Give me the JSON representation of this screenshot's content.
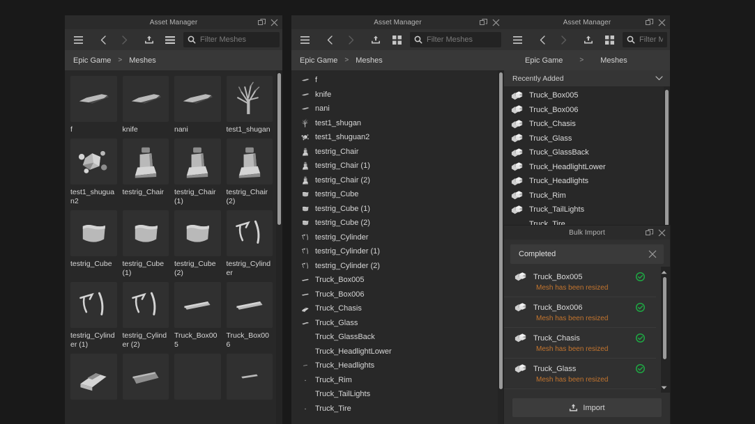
{
  "window": {
    "title": "Asset Manager",
    "undock_icon": "undock-icon",
    "close_icon": "close-icon"
  },
  "toolbar": {
    "menu_icon": "hamburger-menu-icon",
    "back_icon": "chevron-left-icon",
    "forward_icon": "chevron-right-icon",
    "import_icon": "upload-icon",
    "list_view_icon": "list-view-icon",
    "grid_view_icon": "grid-view-icon",
    "search_icon": "search-icon",
    "search_placeholder": "Filter Meshes",
    "search_placeholder_short": "Filter M",
    "search_value": ""
  },
  "breadcrumb": {
    "root": "Epic Game",
    "separator": ">",
    "current": "Meshes"
  },
  "panel_grid": {
    "view_mode": "grid",
    "assets": [
      {
        "label": "f",
        "shape": "knife"
      },
      {
        "label": "knife",
        "shape": "knife"
      },
      {
        "label": "nani",
        "shape": "knife"
      },
      {
        "label": "test1_shugan",
        "shape": "tree"
      },
      {
        "label": "test1_shuguan2",
        "shape": "cluster"
      },
      {
        "label": "testrig_Chair",
        "shape": "chair"
      },
      {
        "label": "testrig_Chair (1)",
        "shape": "chair"
      },
      {
        "label": "testrig_Chair (2)",
        "shape": "chair"
      },
      {
        "label": "testrig_Cube",
        "shape": "cube"
      },
      {
        "label": "testrig_Cube (1)",
        "shape": "cube"
      },
      {
        "label": "testrig_Cube (2)",
        "shape": "cube"
      },
      {
        "label": "testrig_Cylinder",
        "shape": "cylinder"
      },
      {
        "label": "testrig_Cylinder (1)",
        "shape": "cylinder"
      },
      {
        "label": "testrig_Cylinder (2)",
        "shape": "cylinder"
      },
      {
        "label": "Truck_Box005",
        "shape": "box"
      },
      {
        "label": "Truck_Box006",
        "shape": "box"
      }
    ],
    "partial_row": [
      {
        "shape": "chasis"
      },
      {
        "shape": "slab"
      },
      {
        "shape": "blank"
      },
      {
        "shape": "sliver"
      }
    ]
  },
  "panel_list": {
    "view_mode": "list",
    "assets": [
      {
        "label": "f",
        "shape": "knife"
      },
      {
        "label": "knife",
        "shape": "knife"
      },
      {
        "label": "nani",
        "shape": "knife"
      },
      {
        "label": "test1_shugan",
        "shape": "tree"
      },
      {
        "label": "test1_shuguan2",
        "shape": "cluster"
      },
      {
        "label": "testrig_Chair",
        "shape": "chair"
      },
      {
        "label": "testrig_Chair (1)",
        "shape": "chair"
      },
      {
        "label": "testrig_Chair (2)",
        "shape": "chair"
      },
      {
        "label": "testrig_Cube",
        "shape": "cube"
      },
      {
        "label": "testrig_Cube (1)",
        "shape": "cube"
      },
      {
        "label": "testrig_Cube (2)",
        "shape": "cube"
      },
      {
        "label": "testrig_Cylinder",
        "shape": "cylinder"
      },
      {
        "label": "testrig_Cylinder (1)",
        "shape": "cylinder"
      },
      {
        "label": "testrig_Cylinder (2)",
        "shape": "cylinder"
      },
      {
        "label": "Truck_Box005",
        "shape": "box"
      },
      {
        "label": "Truck_Box006",
        "shape": "box"
      },
      {
        "label": "Truck_Chasis",
        "shape": "chasis"
      },
      {
        "label": "Truck_Glass",
        "shape": "glass"
      },
      {
        "label": "Truck_GlassBack",
        "shape": "blank"
      },
      {
        "label": "Truck_HeadlightLower",
        "shape": "blank"
      },
      {
        "label": "Truck_Headlights",
        "shape": "sliver"
      },
      {
        "label": "Truck_Rim",
        "shape": "dot"
      },
      {
        "label": "Truck_TailLights",
        "shape": "blank"
      },
      {
        "label": "Truck_Tire",
        "shape": "dot"
      }
    ]
  },
  "panel_recent": {
    "sort_label": "Recently Added",
    "chevron_icon": "chevron-down-icon",
    "assets": [
      {
        "label": "Truck_Box005"
      },
      {
        "label": "Truck_Box006"
      },
      {
        "label": "Truck_Chasis"
      },
      {
        "label": "Truck_Glass"
      },
      {
        "label": "Truck_GlassBack"
      },
      {
        "label": "Truck_HeadlightLower"
      },
      {
        "label": "Truck_Headlights"
      },
      {
        "label": "Truck_Rim"
      },
      {
        "label": "Truck_TailLights"
      },
      {
        "label": "Truck_Tire"
      }
    ]
  },
  "bulk_import": {
    "title": "Bulk Import",
    "status": "Completed",
    "dismiss_icon": "close-icon",
    "undock_icon": "undock-icon",
    "close_icon": "close-icon",
    "note_color": "#c4752e",
    "success_color": "#1ea843",
    "items": [
      {
        "name": "Truck_Box005",
        "note": "Mesh has been resized",
        "state": "success"
      },
      {
        "name": "Truck_Box006",
        "note": "Mesh has been resized",
        "state": "success"
      },
      {
        "name": "Truck_Chasis",
        "note": "Mesh has been resized",
        "state": "success"
      },
      {
        "name": "Truck_Glass",
        "note": "Mesh has been resized",
        "state": "success"
      }
    ],
    "import_button": "Import",
    "import_button_icon": "upload-icon",
    "scroll_up_icon": "caret-up-icon",
    "scroll_down_icon": "caret-down-icon"
  }
}
